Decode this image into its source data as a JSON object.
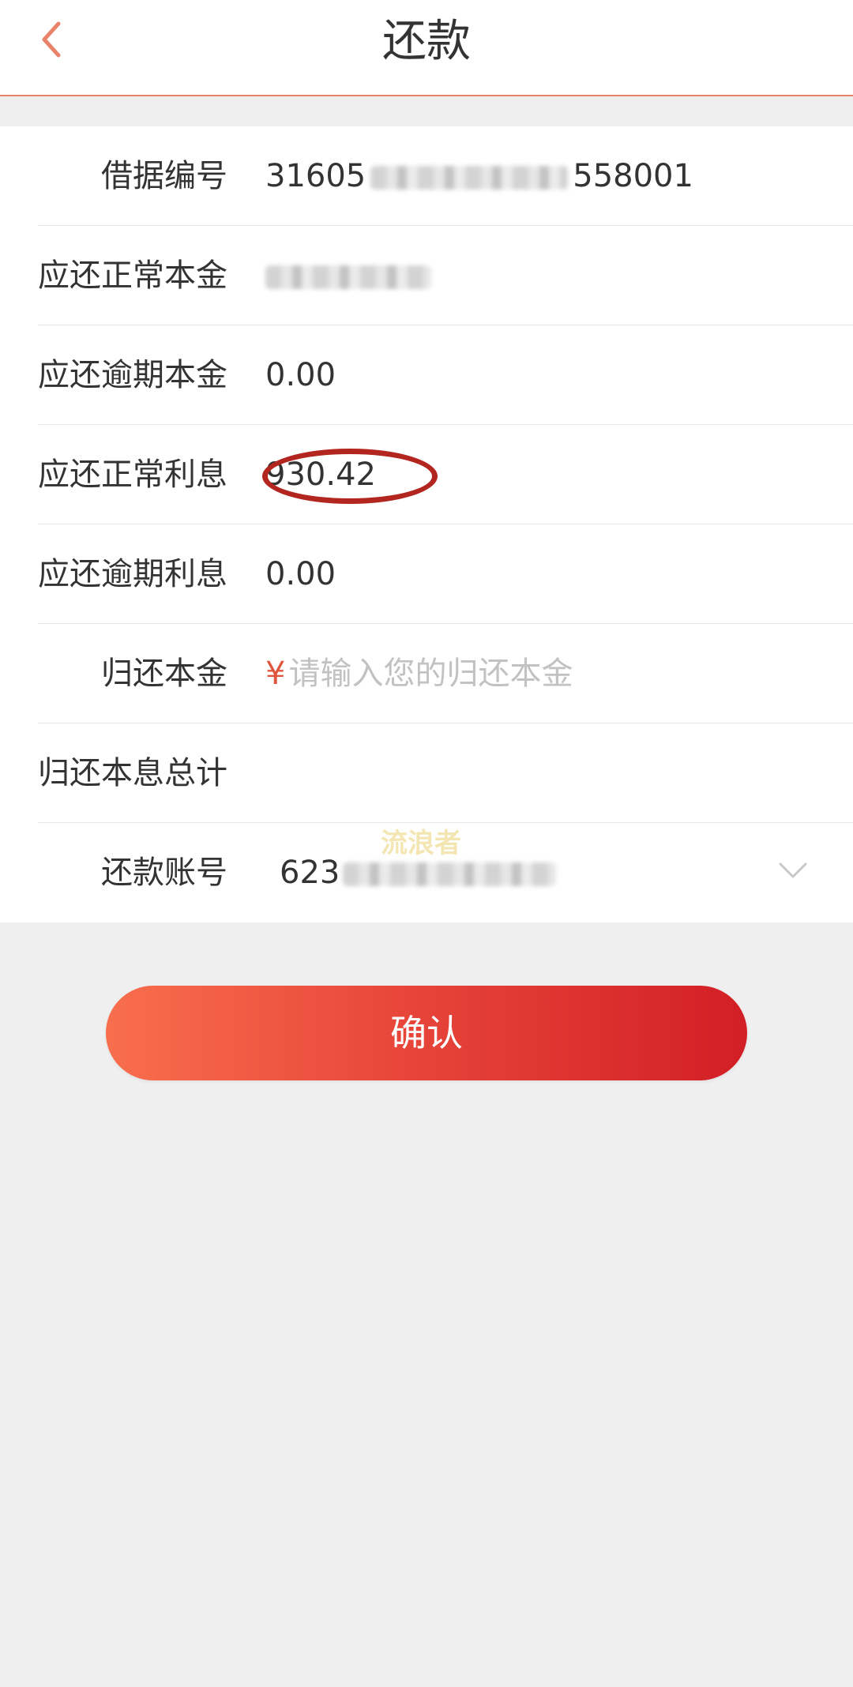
{
  "header": {
    "title": "还款",
    "back_icon": "chevron-left-icon",
    "accent_color": "#e8836a"
  },
  "form": {
    "rows": [
      {
        "label": "借据编号",
        "value_prefix": "31605",
        "value_suffix": "558001"
      },
      {
        "label": "应还正常本金",
        "value_prefix": ""
      },
      {
        "label": "应还逾期本金",
        "value": "0.00"
      },
      {
        "label": "应还正常利息",
        "value": "930.42"
      },
      {
        "label": "应还逾期利息",
        "value": "0.00"
      },
      {
        "label": "归还本金",
        "currency": "¥",
        "placeholder": "请输入您的归还本金"
      },
      {
        "label": "归还本息总计",
        "value": ""
      },
      {
        "label": "还款账号",
        "value_prefix": "623"
      }
    ]
  },
  "watermark": "流浪者",
  "confirm_label": "确认",
  "colors": {
    "button_start": "#f86e4d",
    "button_end": "#d21f26",
    "annotation": "#b3251f",
    "background": "#efefef"
  }
}
